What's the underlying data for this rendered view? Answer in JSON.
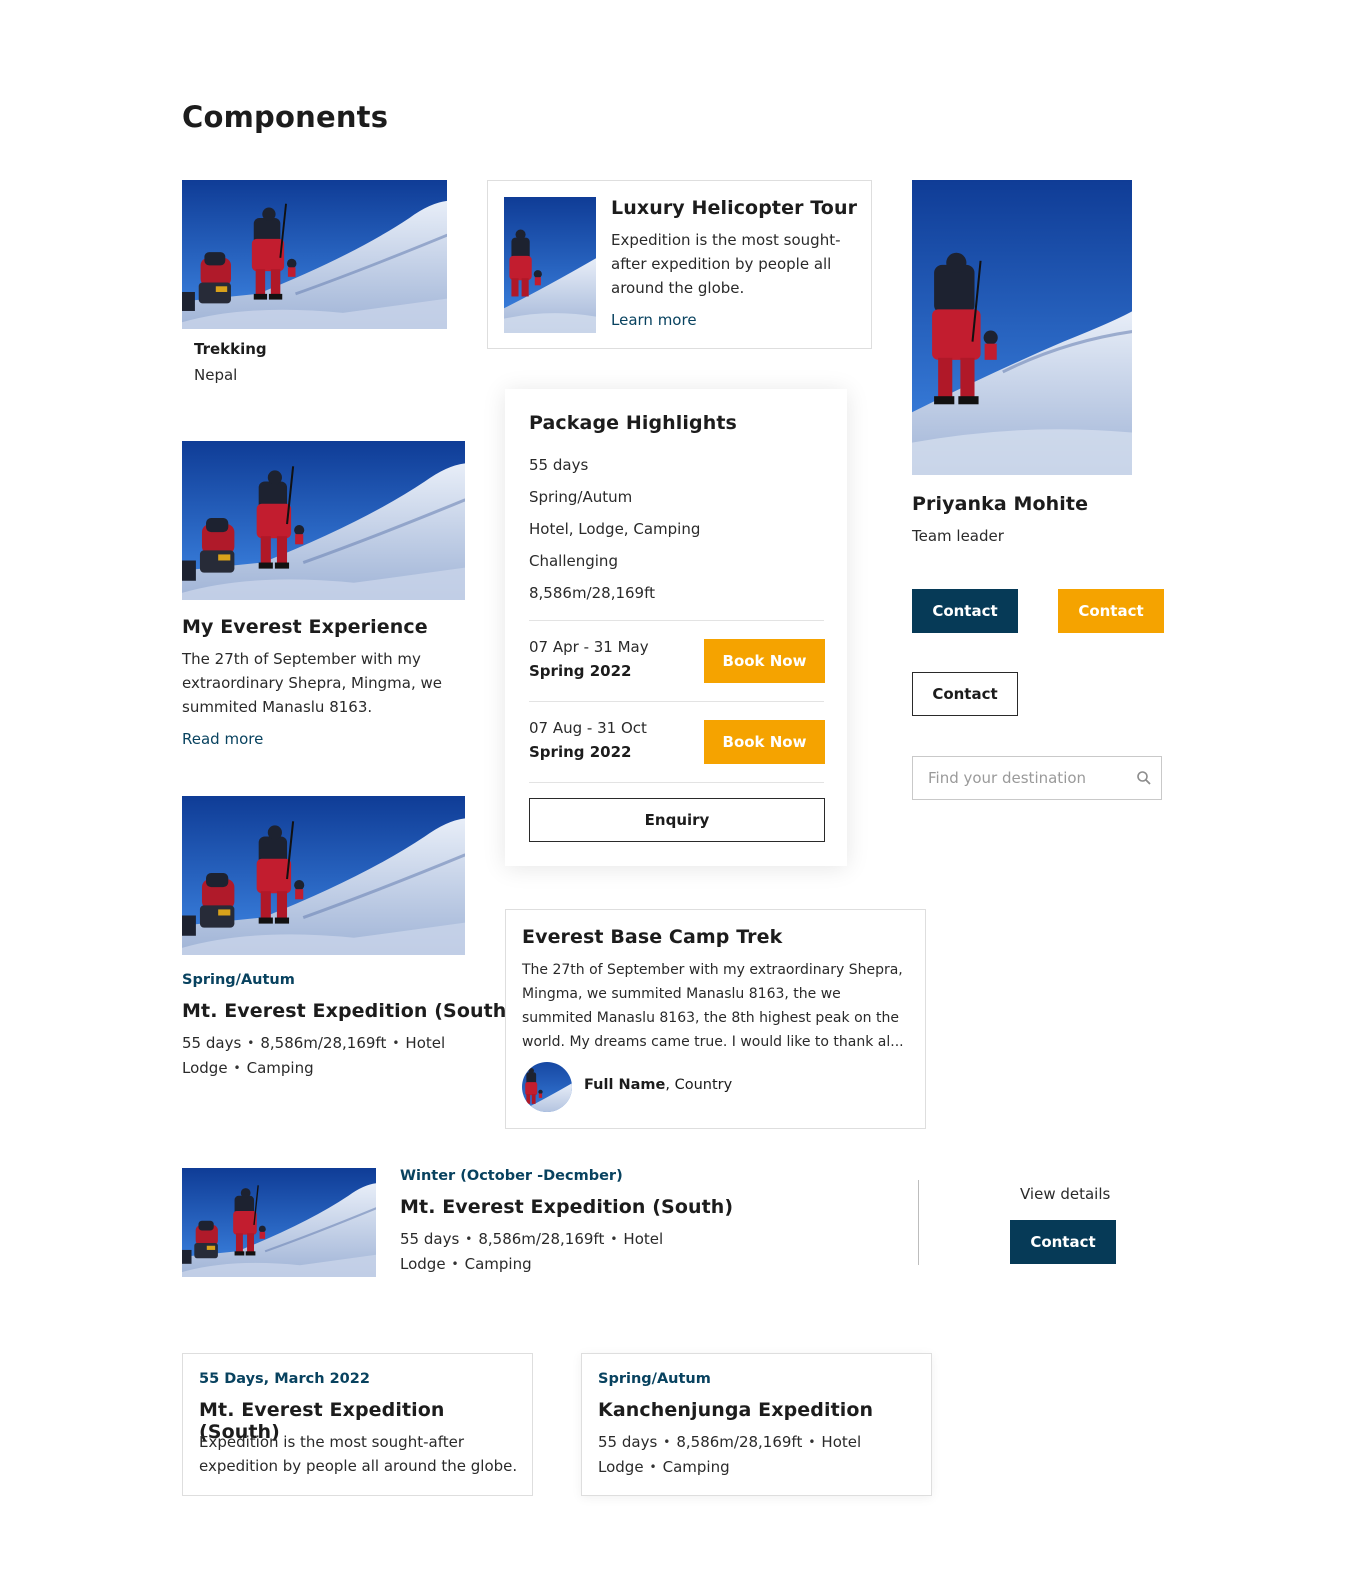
{
  "page": {
    "title": "Components"
  },
  "trek_card": {
    "title": "Trekking",
    "subtitle": "Nepal"
  },
  "helicopter_card": {
    "title": "Luxury Helicopter Tour",
    "description_lines": [
      "Expedition is the most sought-",
      "after expedition by people all",
      "around the globe."
    ],
    "link": "Learn more"
  },
  "leader_card": {
    "name": "Priyanka Mohite",
    "role": "Team leader"
  },
  "buttons": {
    "contact_navy": "Contact",
    "contact_orange": "Contact",
    "contact_outline": "Contact"
  },
  "search": {
    "placeholder": "Find your destination"
  },
  "story_card": {
    "title": "My Everest Experience",
    "lines": [
      "The 27th of September with my",
      "extraordinary Shepra, Mingma, we",
      "summited Manaslu 8163."
    ],
    "link": "Read more"
  },
  "highlights": {
    "title": "Package Highlights",
    "items": [
      "55 days",
      "Spring/Autum",
      "Hotel, Lodge, Camping",
      "Challenging",
      "8,586m/28,169ft"
    ],
    "departures": [
      {
        "dates": "07 Apr - 31 May",
        "season": "Spring 2022",
        "button": "Book Now"
      },
      {
        "dates": "07 Aug - 31 Oct",
        "season": "Spring 2022",
        "button": "Book Now"
      }
    ],
    "enquiry": "Enquiry"
  },
  "expedition_card": {
    "season": "Spring/Autum",
    "title": "Mt. Everest Expedition (South)",
    "meta_line1": [
      "55 days",
      "8,586m/28,169ft",
      "Hotel"
    ],
    "meta_line2": [
      "Lodge",
      "Camping"
    ]
  },
  "review_card": {
    "title": "Everest Base Camp Trek",
    "lines": [
      "The 27th of September with my extraordinary Shepra,",
      "Mingma, we summited Manaslu 8163, the we",
      "summited Manaslu 8163, the 8th highest peak on the",
      "world. My dreams came true. I would like to thank al..."
    ],
    "author_name": "Full Name",
    "author_country": ", Country"
  },
  "list_item": {
    "season": "Winter (October -Decmber)",
    "title": "Mt. Everest Expedition (South)",
    "meta_line1": [
      "55 days",
      "8,586m/28,169ft",
      "Hotel"
    ],
    "meta_line2": [
      "Lodge",
      "Camping"
    ],
    "view_details": "View details",
    "contact": "Contact"
  },
  "small_card_1": {
    "kicker": "55 Days, March 2022",
    "title": "Mt. Everest Expedition (South)",
    "lines": [
      "Expedition is the most sought-after",
      "expedition by people all around the globe."
    ]
  },
  "small_card_2": {
    "kicker": "Spring/Autum",
    "title": "Kanchenjunga Expedition",
    "meta_line1": [
      "55 days",
      "8,586m/28,169ft",
      "Hotel"
    ],
    "meta_line2": [
      "Lodge",
      "Camping"
    ]
  },
  "colors": {
    "navy": "#063a57",
    "orange": "#f5a300",
    "kicker": "#08425f"
  },
  "icons": {
    "search": "search-icon"
  }
}
